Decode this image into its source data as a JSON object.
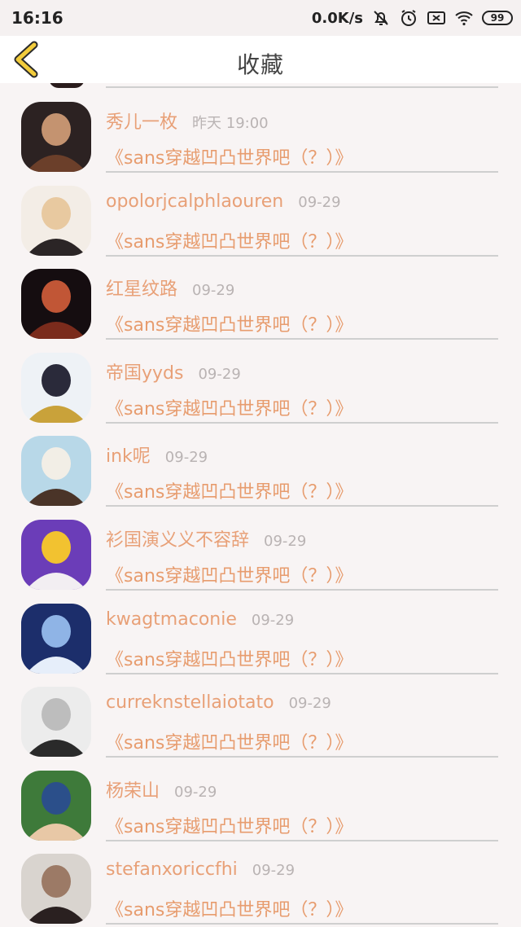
{
  "status_bar": {
    "time": "16:16",
    "net_speed": "0.0K/s",
    "battery": "99",
    "icons": [
      "mute-bell-icon",
      "alarm-icon",
      "sim-off-icon",
      "wifi-icon",
      "battery-icon"
    ]
  },
  "header": {
    "title": "收藏",
    "back_icon": "chevron-left-icon",
    "accent": "#f2cc3c"
  },
  "colors": {
    "name": "#e8a077",
    "work_title": "#e79c6e",
    "time": "#b9b3b3",
    "separator": "#cfcfcf"
  },
  "items": [
    {
      "name": "秀儿一枚",
      "time": "昨天 19:00",
      "work": "《sans穿越凹凸世界吧（？）》",
      "avatar_colors": [
        "#2c2222",
        "#6b3f2a",
        "#c49370"
      ]
    },
    {
      "name": "opolorjcalphlaouren",
      "time": "09-29",
      "work": "《sans穿越凹凸世界吧（？）》",
      "avatar_colors": [
        "#f3ede6",
        "#2b2526",
        "#e8c9a0"
      ]
    },
    {
      "name": "红星纹路",
      "time": "09-29",
      "work": "《sans穿越凹凸世界吧（？）》",
      "avatar_colors": [
        "#150d10",
        "#7a2b1c",
        "#c15636"
      ]
    },
    {
      "name": "帝国yyds",
      "time": "09-29",
      "work": "《sans穿越凹凸世界吧（？）》",
      "avatar_colors": [
        "#eef2f6",
        "#c9a23a",
        "#2a2a3a"
      ]
    },
    {
      "name": "ink呢",
      "time": "09-29",
      "work": "《sans穿越凹凸世界吧（？）》",
      "avatar_colors": [
        "#b8d8e8",
        "#4a3428",
        "#f2eee6"
      ]
    },
    {
      "name": "衫国演义义不容辞",
      "time": "09-29",
      "work": "《sans穿越凹凸世界吧（？）》",
      "avatar_colors": [
        "#6b3db8",
        "#f2eef2",
        "#f2c230"
      ]
    },
    {
      "name": "kwagtmaconie",
      "time": "09-29",
      "work": "《sans穿越凹凸世界吧（？）》",
      "avatar_colors": [
        "#1c2e6b",
        "#e6eefa",
        "#8fb4e6"
      ]
    },
    {
      "name": "curreknstellaiotato",
      "time": "09-29",
      "work": "《sans穿越凹凸世界吧（？）》",
      "avatar_colors": [
        "#ececec",
        "#2a2a2a",
        "#bdbdbd"
      ]
    },
    {
      "name": "杨荣山",
      "time": "09-29",
      "work": "《sans穿越凹凸世界吧（？）》",
      "avatar_colors": [
        "#3e7a3a",
        "#e8c8a6",
        "#2b4f8a"
      ]
    },
    {
      "name": "stefanxoriccfhi",
      "time": "09-29",
      "work": "《sans穿越凹凸世界吧（？）》",
      "avatar_colors": [
        "#d9d4cf",
        "#2a2020",
        "#9c7a66"
      ]
    }
  ]
}
